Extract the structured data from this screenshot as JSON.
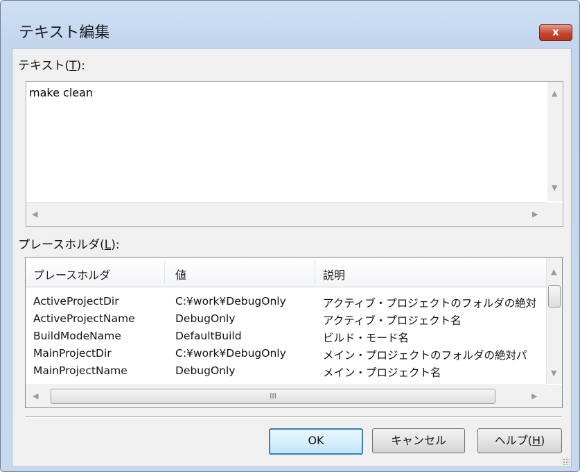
{
  "window": {
    "title": "テキスト編集",
    "close_glyph": "x"
  },
  "text_section": {
    "label_prefix": "テキスト(",
    "label_key": "T",
    "label_suffix": "):",
    "value": "make clean"
  },
  "placeholder_section": {
    "label_prefix": "プレースホルダ(",
    "label_key": "L",
    "label_suffix": "):",
    "columns": [
      "プレースホルダ",
      "値",
      "説明"
    ],
    "rows": [
      {
        "name": "ActiveProjectDir",
        "value": "C:¥work¥DebugOnly",
        "desc": "アクティブ・プロジェクトのフォルダの絶対"
      },
      {
        "name": "ActiveProjectName",
        "value": "DebugOnly",
        "desc": "アクティブ・プロジェクト名"
      },
      {
        "name": "BuildModeName",
        "value": "DefaultBuild",
        "desc": "ビルド・モード名"
      },
      {
        "name": "MainProjectDir",
        "value": "C:¥work¥DebugOnly",
        "desc": "メイン・プロジェクトのフォルダの絶対パ"
      },
      {
        "name": "MainProjectName",
        "value": "DebugOnly",
        "desc": "メイン・プロジェクト名"
      }
    ],
    "hscroll_thumb_glyph": "III"
  },
  "buttons": {
    "ok": "OK",
    "cancel": "キャンセル",
    "help_prefix": "ヘルプ(",
    "help_key": "H",
    "help_suffix": ")"
  }
}
